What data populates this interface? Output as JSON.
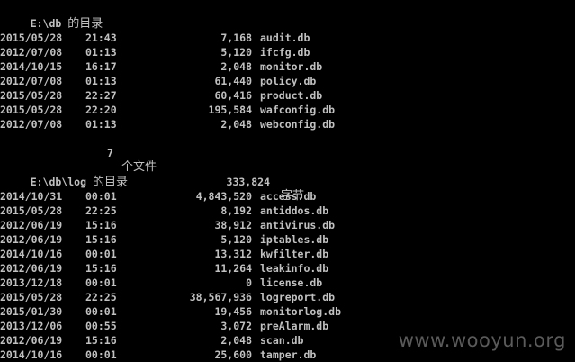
{
  "dir1": {
    "header_path": "E:\\db",
    "header_suffix": "的目录",
    "entries": [
      {
        "date": "2015/05/28",
        "time": "21:43",
        "size": "7,168",
        "name": "audit.db"
      },
      {
        "date": "2012/07/08",
        "time": "01:13",
        "size": "5,120",
        "name": "ifcfg.db"
      },
      {
        "date": "2014/10/15",
        "time": "16:17",
        "size": "2,048",
        "name": "monitor.db"
      },
      {
        "date": "2012/07/08",
        "time": "01:13",
        "size": "61,440",
        "name": "policy.db"
      },
      {
        "date": "2015/05/28",
        "time": "22:27",
        "size": "60,416",
        "name": "product.db"
      },
      {
        "date": "2015/05/28",
        "time": "22:20",
        "size": "195,584",
        "name": "wafconfig.db"
      },
      {
        "date": "2012/07/08",
        "time": "01:13",
        "size": "2,048",
        "name": "webconfig.db"
      }
    ],
    "summary": {
      "count": "7",
      "count_label": "个文件",
      "bytes": "333,824",
      "bytes_label": "字节"
    }
  },
  "dir2": {
    "header_path": "E:\\db\\log",
    "header_suffix": "的目录",
    "entries": [
      {
        "date": "2014/10/31",
        "time": "00:01",
        "size": "4,843,520",
        "name": "access.db"
      },
      {
        "date": "2015/05/28",
        "time": "22:25",
        "size": "8,192",
        "name": "antiddos.db"
      },
      {
        "date": "2012/06/19",
        "time": "15:16",
        "size": "38,912",
        "name": "antivirus.db"
      },
      {
        "date": "2012/06/19",
        "time": "15:16",
        "size": "5,120",
        "name": "iptables.db"
      },
      {
        "date": "2014/10/16",
        "time": "00:01",
        "size": "13,312",
        "name": "kwfilter.db"
      },
      {
        "date": "2012/06/19",
        "time": "15:16",
        "size": "11,264",
        "name": "leakinfo.db"
      },
      {
        "date": "2013/12/18",
        "time": "00:01",
        "size": "0",
        "name": "license.db"
      },
      {
        "date": "2015/05/28",
        "time": "22:25",
        "size": "38,567,936",
        "name": "logreport.db"
      },
      {
        "date": "2015/01/30",
        "time": "00:01",
        "size": "19,456",
        "name": "monitorlog.db"
      },
      {
        "date": "2013/12/06",
        "time": "00:55",
        "size": "3,072",
        "name": "preAlarm.db"
      },
      {
        "date": "2012/06/19",
        "time": "15:16",
        "size": "2,048",
        "name": "scan.db"
      },
      {
        "date": "2014/10/16",
        "time": "00:01",
        "size": "25,600",
        "name": "tamper.db"
      }
    ]
  },
  "watermark": "www.wooyun.org",
  "colors": {
    "background": "#000000",
    "text": "#c0c0c0",
    "watermark": "#5a5a5a"
  }
}
